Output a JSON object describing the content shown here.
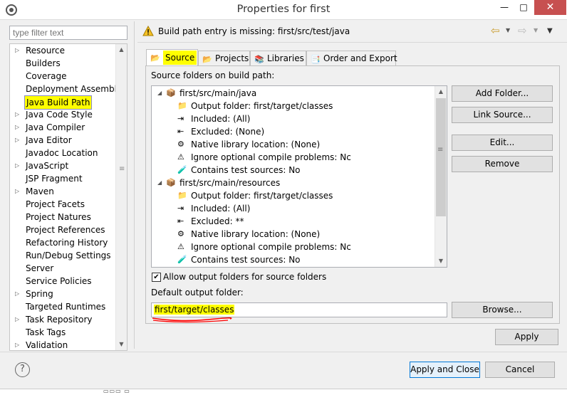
{
  "window": {
    "title": "Properties for first",
    "min_glyph": "—",
    "max_glyph": "□",
    "close_glyph": "✕"
  },
  "filter": {
    "placeholder": "type filter text"
  },
  "left_tree": [
    {
      "label": "Resource",
      "expandable": true
    },
    {
      "label": "Builders",
      "expandable": false
    },
    {
      "label": "Coverage",
      "expandable": false
    },
    {
      "label": "Deployment Assembly",
      "expandable": false
    },
    {
      "label": "Java Build Path",
      "expandable": false,
      "selected": true
    },
    {
      "label": "Java Code Style",
      "expandable": true
    },
    {
      "label": "Java Compiler",
      "expandable": true
    },
    {
      "label": "Java Editor",
      "expandable": true
    },
    {
      "label": "Javadoc Location",
      "expandable": false
    },
    {
      "label": "JavaScript",
      "expandable": true
    },
    {
      "label": "JSP Fragment",
      "expandable": false
    },
    {
      "label": "Maven",
      "expandable": true
    },
    {
      "label": "Project Facets",
      "expandable": false
    },
    {
      "label": "Project Natures",
      "expandable": false
    },
    {
      "label": "Project References",
      "expandable": false
    },
    {
      "label": "Refactoring History",
      "expandable": false
    },
    {
      "label": "Run/Debug Settings",
      "expandable": false
    },
    {
      "label": "Server",
      "expandable": false
    },
    {
      "label": "Service Policies",
      "expandable": false
    },
    {
      "label": "Spring",
      "expandable": true
    },
    {
      "label": "Targeted Runtimes",
      "expandable": false
    },
    {
      "label": "Task Repository",
      "expandable": true
    },
    {
      "label": "Task Tags",
      "expandable": false
    },
    {
      "label": "Validation",
      "expandable": true
    }
  ],
  "banner": {
    "message": "Build path entry is missing: first/src/test/java"
  },
  "tabs": [
    {
      "label": "Source",
      "icon": "source-folder-icon",
      "active": true
    },
    {
      "label": "Projects",
      "icon": "projects-icon"
    },
    {
      "label": "Libraries",
      "icon": "libraries-icon"
    },
    {
      "label": "Order and Export",
      "icon": "order-export-icon"
    }
  ],
  "source_tab": {
    "section_label": "Source folders on build path:",
    "entries": [
      {
        "level": 0,
        "icon": "package-folder-icon",
        "text": "first/src/main/java"
      },
      {
        "level": 1,
        "icon": "output-folder-icon",
        "text": "Output folder: first/target/classes"
      },
      {
        "level": 1,
        "icon": "included-icon",
        "text": "Included: (All)"
      },
      {
        "level": 1,
        "icon": "excluded-icon",
        "text": "Excluded: (None)"
      },
      {
        "level": 1,
        "icon": "native-library-icon",
        "text": "Native library location: (None)"
      },
      {
        "level": 1,
        "icon": "ignore-problems-icon",
        "text": "Ignore optional compile problems: Nc"
      },
      {
        "level": 1,
        "icon": "test-sources-icon",
        "text": "Contains test sources: No"
      },
      {
        "level": 0,
        "icon": "package-folder-icon",
        "text": "first/src/main/resources"
      },
      {
        "level": 1,
        "icon": "output-folder-icon",
        "text": "Output folder: first/target/classes"
      },
      {
        "level": 1,
        "icon": "included-icon",
        "text": "Included: (All)"
      },
      {
        "level": 1,
        "icon": "excluded-icon",
        "text": "Excluded: **"
      },
      {
        "level": 1,
        "icon": "native-library-icon",
        "text": "Native library location: (None)"
      },
      {
        "level": 1,
        "icon": "ignore-problems-icon",
        "text": "Ignore optional compile problems: Nc"
      },
      {
        "level": 1,
        "icon": "test-sources-icon",
        "text": "Contains test sources: No"
      }
    ],
    "buttons": {
      "add_folder": "Add Folder...",
      "link_source": "Link Source...",
      "edit": "Edit...",
      "remove": "Remove"
    },
    "allow_output_label": "Allow output folders for source folders",
    "allow_output_checked": true,
    "default_output_label": "Default output folder:",
    "default_output_value": "first/target/classes",
    "browse": "Browse..."
  },
  "apply": "Apply",
  "apply_close": "Apply and Close",
  "cancel": "Cancel",
  "colors": {
    "highlight": "#ffff00",
    "annotation_underline": "#ff0000",
    "close_button": "#c75050"
  }
}
